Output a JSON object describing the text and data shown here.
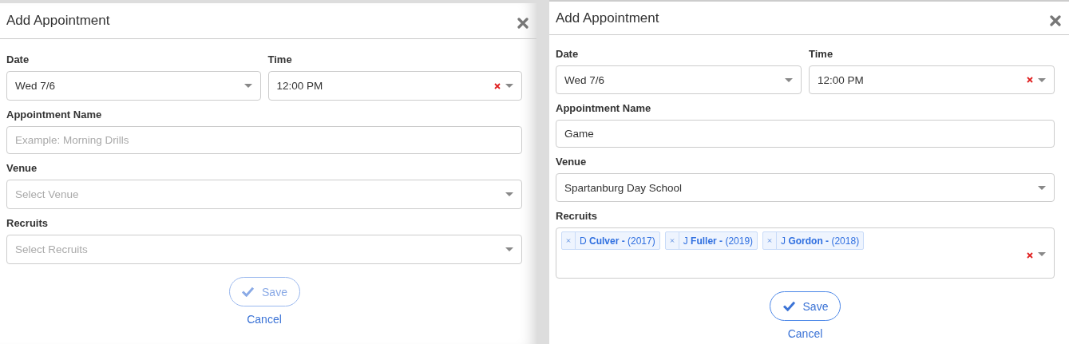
{
  "dialogs": [
    {
      "title": "Add Appointment",
      "date": {
        "label": "Date",
        "value": "Wed 7/6"
      },
      "time": {
        "label": "Time",
        "value": "12:00 PM",
        "clearable": true
      },
      "appointment_name": {
        "label": "Appointment Name",
        "placeholder": "Example: Morning Drills"
      },
      "venue": {
        "label": "Venue",
        "placeholder": "Select Venue"
      },
      "recruits": {
        "label": "Recruits",
        "placeholder": "Select Recruits",
        "clearable": false
      },
      "save": {
        "label": "Save",
        "disabled": true
      },
      "cancel": "Cancel"
    },
    {
      "title": "Add Appointment",
      "date": {
        "label": "Date",
        "value": "Wed 7/6"
      },
      "time": {
        "label": "Time",
        "value": "12:00 PM",
        "clearable": true
      },
      "appointment_name": {
        "label": "Appointment Name",
        "value": "Game"
      },
      "venue": {
        "label": "Venue",
        "value": "Spartanburg Day School"
      },
      "recruits": {
        "label": "Recruits",
        "clearable": true,
        "tags": [
          "D **Culver -** (2017)",
          "J **Fuller -** (2019)",
          "J **Gordon -** (2018)"
        ]
      },
      "save": {
        "label": "Save",
        "disabled": false
      },
      "cancel": "Cancel"
    }
  ]
}
